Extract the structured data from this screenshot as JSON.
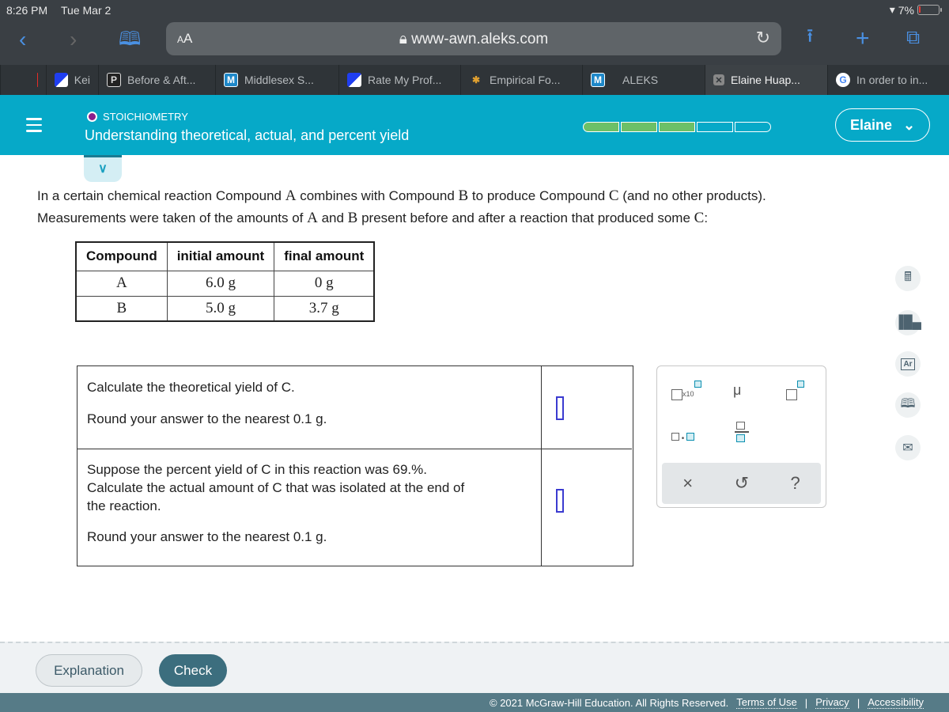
{
  "status_bar": {
    "time": "8:26 PM",
    "date": "Tue Mar 2",
    "battery": "7%"
  },
  "browser": {
    "text_size_label": "AA",
    "url": "www-awn.aleks.com",
    "bookmarks": [
      {
        "label": "",
        "icon": "youtube-icon"
      },
      {
        "label": "Kei",
        "icon": "ratemyprof-icon"
      },
      {
        "label": "Before & Aft...",
        "icon": "p-icon"
      },
      {
        "label": "Middlesex S...",
        "icon": "m-icon"
      },
      {
        "label": "Rate My Prof...",
        "icon": "ratemyprof-icon"
      },
      {
        "label": "Empirical Fo...",
        "icon": "molecule-icon"
      },
      {
        "label": "ALEKS",
        "icon": "m-icon"
      },
      {
        "label": "Elaine Huap...",
        "icon": "close-icon",
        "active": true
      },
      {
        "label": "In order to in...",
        "icon": "google-icon"
      }
    ]
  },
  "header": {
    "topic": "STOICHIOMETRY",
    "title": "Understanding theoretical, actual, and percent yield",
    "progress": {
      "completed": 3,
      "total": 5
    },
    "user": "Elaine",
    "accent": "#06a9c8",
    "progress_color": "#6cc067"
  },
  "problem": {
    "intro_parts": [
      "In a certain chemical reaction Compound ",
      "A",
      " combines with Compound ",
      "B",
      " to produce Compound ",
      "C",
      " (and no other products).",
      "Measurements were taken of the amounts of ",
      "A",
      " and ",
      "B",
      " present before and after a reaction that produced some ",
      "C",
      ":"
    ],
    "table": {
      "headers": [
        "Compound",
        "initial amount",
        "final amount"
      ],
      "rows": [
        [
          "A",
          "6.0 g",
          "0 g"
        ],
        [
          "B",
          "5.0 g",
          "3.7 g"
        ]
      ]
    },
    "questions": [
      {
        "lines": [
          "Calculate the theoretical yield of C."
        ],
        "round": "Round your answer to the nearest 0.1 g.",
        "answer": ""
      },
      {
        "lines": [
          "Suppose the percent yield of C in this reaction was 69.%.",
          "Calculate the actual amount of C that was isolated at the end of",
          "the reaction."
        ],
        "round": "Round your answer to the nearest 0.1 g.",
        "answer": ""
      }
    ]
  },
  "palette": {
    "keys": [
      "x10",
      "μ",
      "superscript",
      "decimal",
      "fraction"
    ],
    "actions": [
      "×",
      "↺",
      "?"
    ]
  },
  "side_tools": [
    "calculator-icon",
    "chart-icon",
    "periodic-table-icon",
    "textbook-icon",
    "mail-icon"
  ],
  "buttons": {
    "explanation": "Explanation",
    "check": "Check"
  },
  "footer": {
    "copyright": "© 2021 McGraw-Hill Education. All Rights Reserved.",
    "links": [
      "Terms of Use",
      "Privacy",
      "Accessibility"
    ],
    "separator": "|"
  }
}
